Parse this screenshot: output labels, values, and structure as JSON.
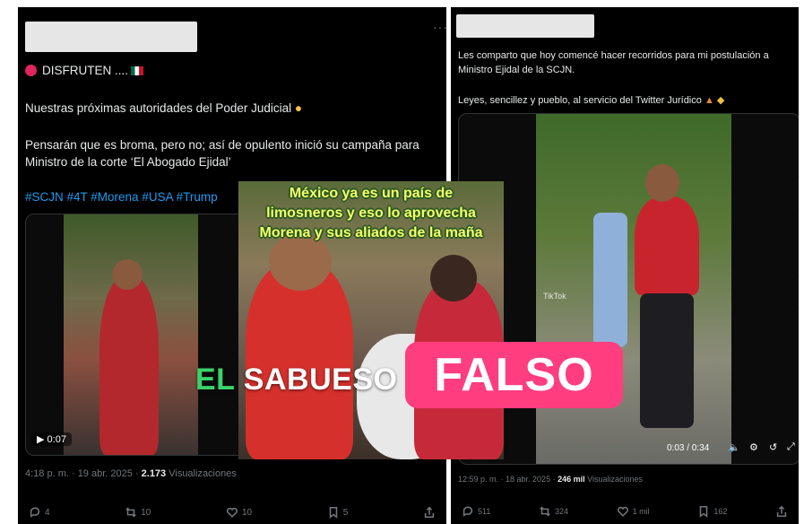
{
  "left_post": {
    "line1": "DISFRUTEN ....",
    "line2": "Nuestras próximas autoridades del Poder Judicial",
    "line3": "Pensarán que es broma, pero no; así de opulento inició su campaña para",
    "line4": "Ministro de la corte ‘El Abogado Ejidal’",
    "hashtags": "#SCJN #4T #Morena #USA #Trump",
    "video_time": "0:07",
    "timestamp": "4:18 p. m. · 19 abr. 2025 ·",
    "views_count": "2.173",
    "views_label": "Visualizaciones",
    "actions": {
      "replies": "4",
      "reposts": "10",
      "likes": "10",
      "bookmarks": "5"
    }
  },
  "right_post": {
    "line1": "Les comparto que hoy comencé hacer recorridos para mi postulación a",
    "line2": "Ministro Ejidal de la SCJN.",
    "line3": "Leyes, sencillez y pueblo, al servicio del Twitter Jurídico",
    "video_time": "0:03 / 0:34",
    "tiktok_label": "TikTok",
    "timestamp": "12:59 p. m. · 18 abr. 2025 ·",
    "views_count": "246 mil",
    "views_label": "Visualizaciones",
    "actions": {
      "replies": "511",
      "reposts": "324",
      "likes": "1 mil",
      "bookmarks": "162"
    }
  },
  "overlay": {
    "caption_1": "México ya es un país de",
    "caption_2": "limosneros y eso lo aprovecha",
    "caption_3": "Morena y sus aliados de la maña"
  },
  "brand": {
    "el": "EL",
    "rest": "SABUESO"
  },
  "verdict": "FALSO",
  "colors": {
    "verdict_bg": "#ff3d7f",
    "hashtag": "#1d9bf0",
    "caption": "#f7ff6b"
  }
}
